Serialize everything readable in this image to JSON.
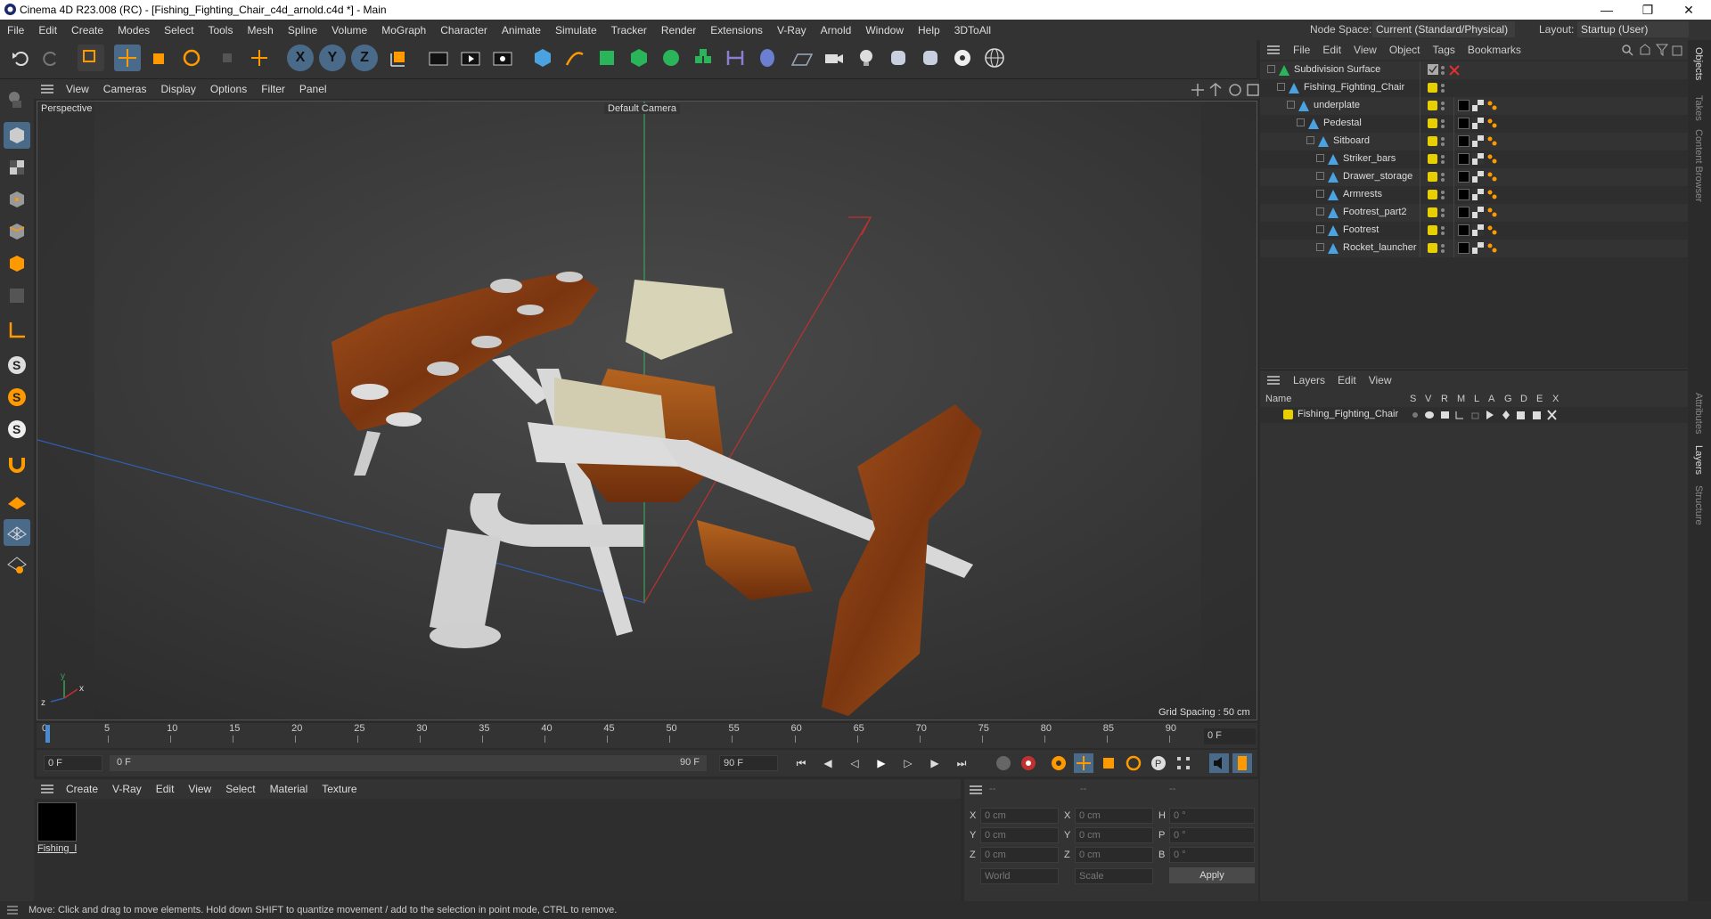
{
  "window": {
    "title": "Cinema 4D R23.008 (RC) - [Fishing_Fighting_Chair_c4d_arnold.c4d *] - Main"
  },
  "menu": [
    "File",
    "Edit",
    "Create",
    "Modes",
    "Select",
    "Tools",
    "Mesh",
    "Spline",
    "Volume",
    "MoGraph",
    "Character",
    "Animate",
    "Simulate",
    "Tracker",
    "Render",
    "Extensions",
    "V-Ray",
    "Arnold",
    "Window",
    "Help",
    "3DToAll"
  ],
  "node_space": {
    "label": "Node Space:",
    "value": "Current (Standard/Physical)"
  },
  "layout": {
    "label": "Layout:",
    "value": "Startup (User)"
  },
  "viewport": {
    "menu": [
      "View",
      "Cameras",
      "Display",
      "Options",
      "Filter",
      "Panel"
    ],
    "name": "Perspective",
    "camera": "Default Camera",
    "grid_spacing": "Grid Spacing : 50 cm"
  },
  "timeline": {
    "ticks": [
      "0",
      "5",
      "10",
      "15",
      "20",
      "25",
      "30",
      "35",
      "40",
      "45",
      "50",
      "55",
      "60",
      "65",
      "70",
      "75",
      "80",
      "85",
      "90"
    ],
    "current_frame": "0 F",
    "start": "0 F",
    "range_start": "0 F",
    "range_end": "90 F",
    "end": "90 F"
  },
  "material_manager": {
    "menu": [
      "Create",
      "V-Ray",
      "Edit",
      "View",
      "Select",
      "Material",
      "Texture"
    ],
    "materials": [
      {
        "name": "Fishing_l",
        "color": "#000000"
      }
    ]
  },
  "coordinates": {
    "header": [
      "--",
      "--",
      "--"
    ],
    "rows": [
      {
        "a": "X",
        "av": "0 cm",
        "b": "X",
        "bv": "0 cm",
        "c": "H",
        "cv": "0 °"
      },
      {
        "a": "Y",
        "av": "0 cm",
        "b": "Y",
        "bv": "0 cm",
        "c": "P",
        "cv": "0 °"
      },
      {
        "a": "Z",
        "av": "0 cm",
        "b": "Z",
        "bv": "0 cm",
        "c": "B",
        "cv": "0 °"
      }
    ],
    "space": "World",
    "mode": "Scale",
    "apply": "Apply"
  },
  "objects_panel": {
    "menu": [
      "File",
      "Edit",
      "View",
      "Object",
      "Tags",
      "Bookmarks"
    ],
    "items": [
      {
        "name": "Subdivision Surface",
        "depth": 0
      },
      {
        "name": "Fishing_Fighting_Chair",
        "depth": 1
      },
      {
        "name": "underplate",
        "depth": 2
      },
      {
        "name": "Pedestal",
        "depth": 3
      },
      {
        "name": "Sitboard",
        "depth": 4
      },
      {
        "name": "Striker_bars",
        "depth": 5
      },
      {
        "name": "Drawer_storage",
        "depth": 5
      },
      {
        "name": "Armrests",
        "depth": 5
      },
      {
        "name": "Footrest_part2",
        "depth": 5
      },
      {
        "name": "Footrest",
        "depth": 5
      },
      {
        "name": "Rocket_launcher",
        "depth": 5
      }
    ]
  },
  "layers_panel": {
    "menu": [
      "Layers",
      "Edit",
      "View"
    ],
    "columns": [
      "Name",
      "S",
      "V",
      "R",
      "M",
      "L",
      "A",
      "G",
      "D",
      "E",
      "X"
    ],
    "layers": [
      {
        "name": "Fishing_Fighting_Chair",
        "color": "#e8d000"
      }
    ]
  },
  "side_tabs": [
    "Objects",
    "Takes",
    "Content Browser",
    "Attributes",
    "Layers",
    "Structure"
  ],
  "status": "Move: Click and drag to move elements. Hold down SHIFT to quantize movement / add to the selection in point mode, CTRL to remove.",
  "colors": {
    "accent": "#e8d000",
    "wood": "#8a3e10",
    "panel": "#333333"
  }
}
